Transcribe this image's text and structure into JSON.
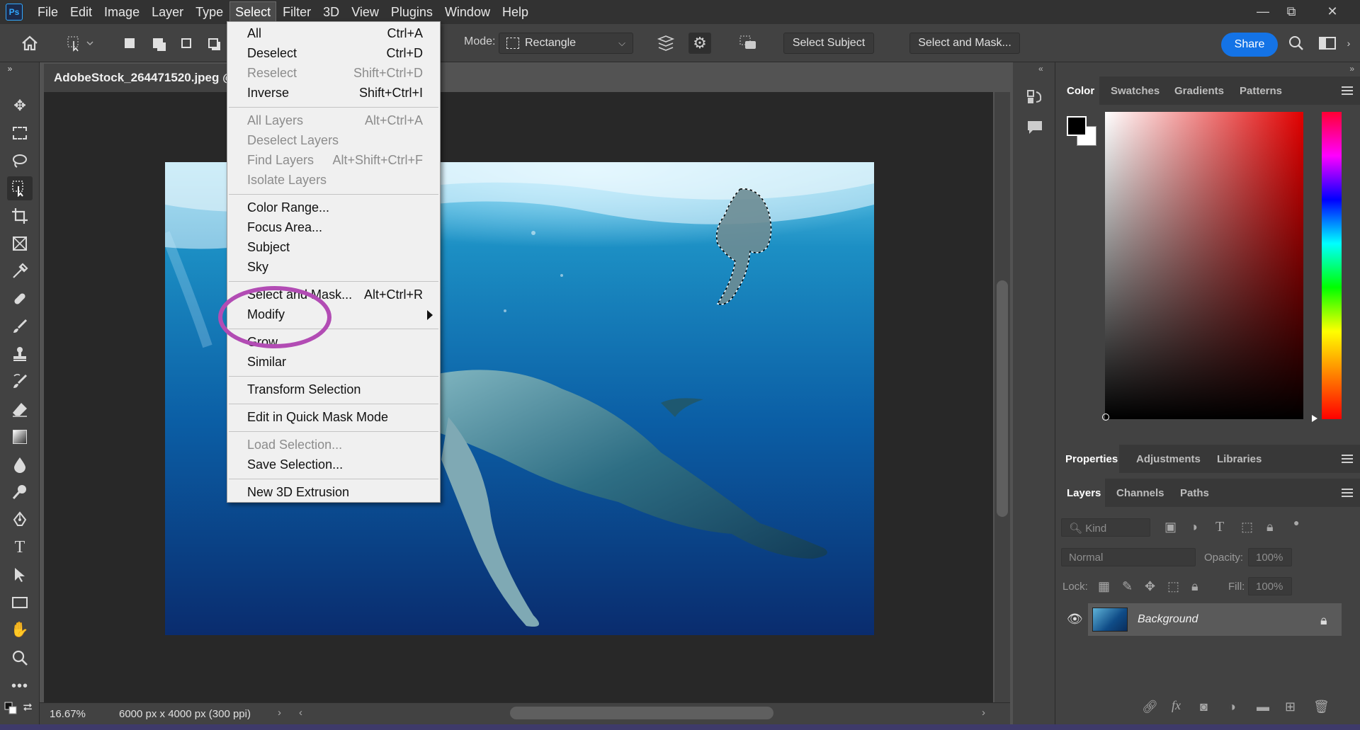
{
  "app": {
    "logo": "Ps"
  },
  "menubar": {
    "items": [
      "File",
      "Edit",
      "Image",
      "Layer",
      "Type",
      "Select",
      "Filter",
      "3D",
      "View",
      "Plugins",
      "Window",
      "Help"
    ],
    "active": "Select"
  },
  "window_controls": {
    "minimize": "—",
    "restore": "⧉",
    "close": "✕"
  },
  "options_bar": {
    "mode_label": "Mode:",
    "mode_value": "Rectangle",
    "select_subject": "Select Subject",
    "select_and_mask": "Select and Mask...",
    "share": "Share"
  },
  "document": {
    "tab_title": "AdobeStock_264471520.jpeg @",
    "zoom": "16.67%",
    "dimensions": "6000 px x 4000 px (300 ppi)"
  },
  "select_menu": {
    "items": [
      {
        "label": "All",
        "shortcut": "Ctrl+A",
        "disabled": false
      },
      {
        "label": "Deselect",
        "shortcut": "Ctrl+D",
        "disabled": false
      },
      {
        "label": "Reselect",
        "shortcut": "Shift+Ctrl+D",
        "disabled": true
      },
      {
        "label": "Inverse",
        "shortcut": "Shift+Ctrl+I",
        "disabled": false
      },
      {
        "label": "All Layers",
        "shortcut": "Alt+Ctrl+A",
        "disabled": true
      },
      {
        "label": "Deselect Layers",
        "shortcut": "",
        "disabled": true
      },
      {
        "label": "Find Layers",
        "shortcut": "Alt+Shift+Ctrl+F",
        "disabled": true
      },
      {
        "label": "Isolate Layers",
        "shortcut": "",
        "disabled": true
      },
      {
        "label": "Color Range...",
        "shortcut": "",
        "disabled": false
      },
      {
        "label": "Focus Area...",
        "shortcut": "",
        "disabled": false
      },
      {
        "label": "Subject",
        "shortcut": "",
        "disabled": false
      },
      {
        "label": "Sky",
        "shortcut": "",
        "disabled": false
      },
      {
        "label": "Select and Mask...",
        "shortcut": "Alt+Ctrl+R",
        "disabled": false
      },
      {
        "label": "Modify",
        "shortcut": "",
        "disabled": false
      },
      {
        "label": "Grow",
        "shortcut": "",
        "disabled": false
      },
      {
        "label": "Similar",
        "shortcut": "",
        "disabled": false
      },
      {
        "label": "Transform Selection",
        "shortcut": "",
        "disabled": false
      },
      {
        "label": "Edit in Quick Mask Mode",
        "shortcut": "",
        "disabled": false
      },
      {
        "label": "Load Selection...",
        "shortcut": "",
        "disabled": true
      },
      {
        "label": "Save Selection...",
        "shortcut": "",
        "disabled": false
      },
      {
        "label": "New 3D Extrusion",
        "shortcut": "",
        "disabled": false
      }
    ]
  },
  "color_panel": {
    "tabs": [
      "Color",
      "Swatches",
      "Gradients",
      "Patterns"
    ],
    "fg_color": "#000000",
    "bg_color": "#ffffff"
  },
  "properties_panel": {
    "tabs": [
      "Properties",
      "Adjustments",
      "Libraries"
    ]
  },
  "layers_panel": {
    "tabs": [
      "Layers",
      "Channels",
      "Paths"
    ],
    "filter_placeholder": "Kind",
    "blend_mode": "Normal",
    "opacity_label": "Opacity:",
    "opacity_value": "100%",
    "lock_label": "Lock:",
    "fill_label": "Fill:",
    "fill_value": "100%",
    "layers": [
      {
        "name": "Background",
        "locked": true,
        "visible": true
      }
    ]
  },
  "accent_colors": {
    "share": "#1473e6",
    "highlight_circle": "#b24cb4"
  }
}
